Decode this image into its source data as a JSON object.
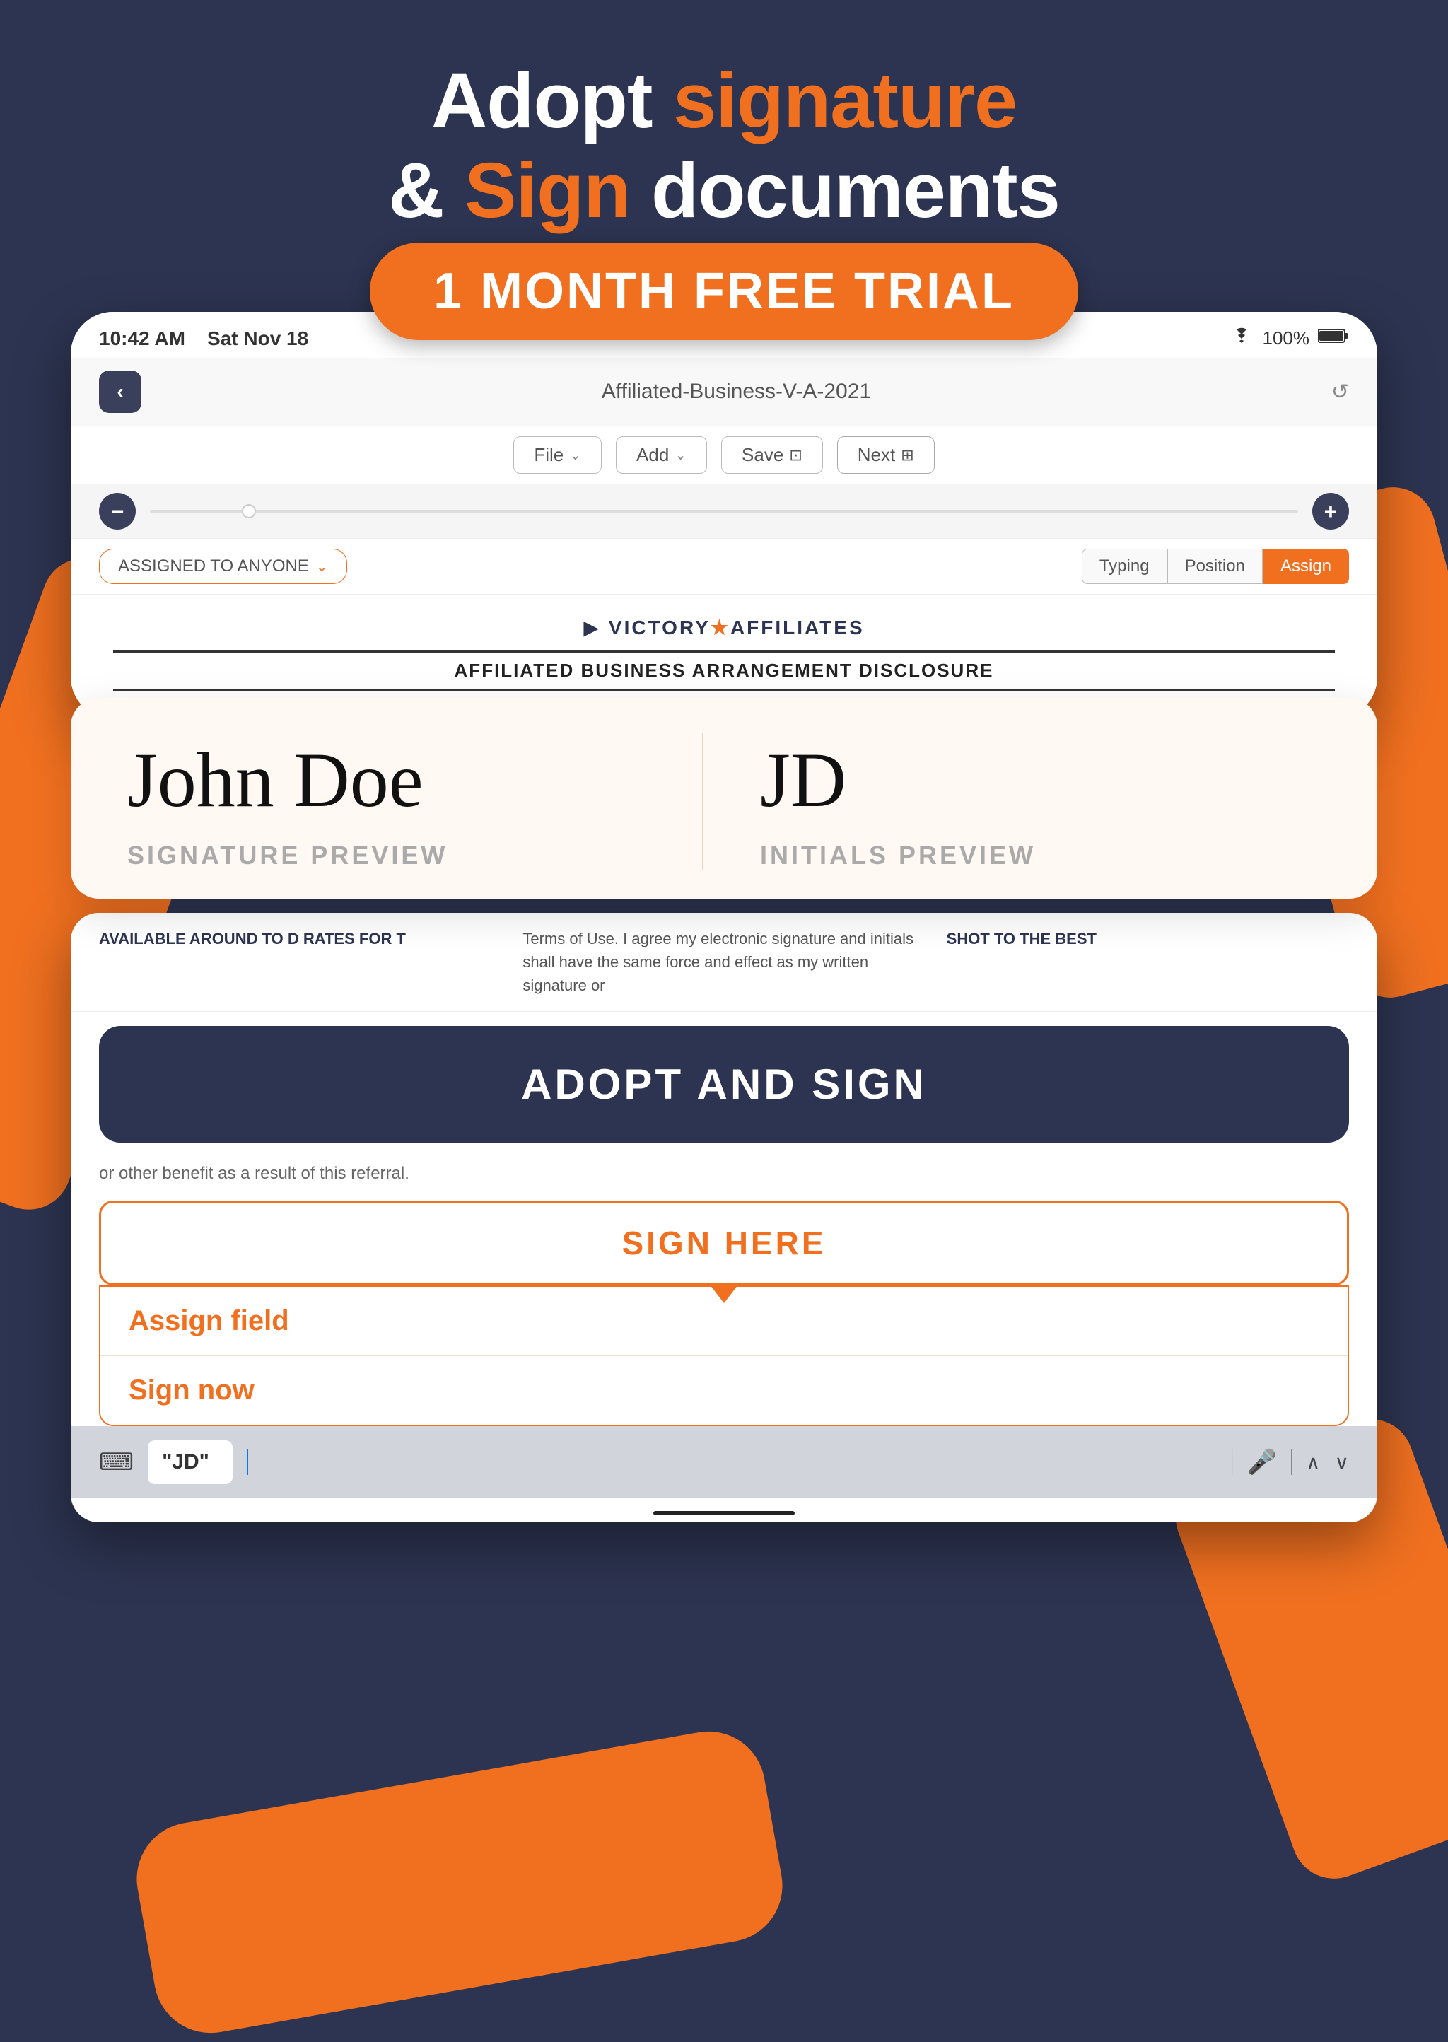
{
  "page": {
    "background_color": "#2d3451"
  },
  "header": {
    "line1_plain": "Adopt ",
    "line1_orange": "signature",
    "line2_plain": "& ",
    "line2_orange": "Sign",
    "line2_suffix": " documents"
  },
  "trial_badge": {
    "label": "1 MONTH FREE TRIAL"
  },
  "device": {
    "status_bar": {
      "time": "10:42 AM",
      "date": "Sat Nov 18",
      "battery": "100%",
      "wifi_icon": "wifi"
    },
    "nav": {
      "back_icon": "‹",
      "title": "Affiliated-Business-V-A-2021",
      "refresh_icon": "↺"
    },
    "toolbar": {
      "file_label": "File",
      "add_label": "Add",
      "save_label": "Save",
      "next_label": "Next"
    },
    "zoom": {
      "minus_label": "−",
      "plus_label": "+"
    },
    "assigned_bar": {
      "chip_label": "ASSIGNED TO ANYONE",
      "chip_arrow": "⌄",
      "tab_typing": "Typing",
      "tab_position": "Position",
      "tab_assign": "Assign"
    },
    "doc": {
      "logo_flag": "🏴",
      "logo_text": "VICTORY★AFFILIATES",
      "logo_star_color": "#f07020",
      "title": "AFFILIATED BUSINESS ARRANGEMENT DISCLOSURE"
    }
  },
  "signature_card": {
    "signature_text": "John Doe",
    "initials_text": "JD",
    "sig_label": "SIGNATURE PREVIEW",
    "initials_label": "INITIALS PREVIEW"
  },
  "bottom_doc": {
    "text_left": "AVAILABLE AROUND TO D RATES FOR T",
    "terms_text": "Terms of Use. I agree my electronic signature and initials shall have the same force and effect as my written signature or",
    "text_right": "SHOT TO THE BEST",
    "other_benefit": "or other benefit as a result of this referral.",
    "adopt_sign_label": "ADOPT AND SIGN",
    "sign_here_label": "SIGN HERE",
    "dropdown": {
      "item1": "Assign field",
      "item2": "Sign now"
    },
    "keyboard": {
      "field_value": "\"JD\"",
      "mic_icon": "🎤"
    }
  }
}
